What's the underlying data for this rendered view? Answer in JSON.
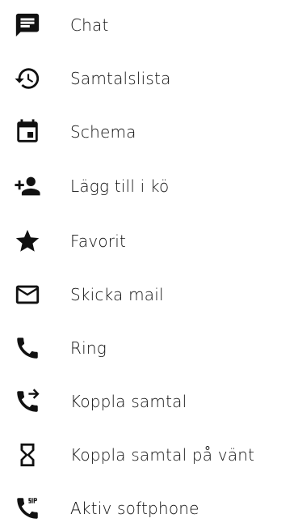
{
  "menu": {
    "items": [
      {
        "id": "chat",
        "label": "Chat",
        "icon": "chat-icon"
      },
      {
        "id": "call-list",
        "label": "Samtalslista",
        "icon": "history-icon"
      },
      {
        "id": "schedule",
        "label": "Schema",
        "icon": "calendar-icon"
      },
      {
        "id": "add-to-queue",
        "label": "Lägg till i kö",
        "icon": "person-add-icon"
      },
      {
        "id": "favorite",
        "label": "Favorit",
        "icon": "star-icon"
      },
      {
        "id": "send-mail",
        "label": "Skicka mail",
        "icon": "mail-icon"
      },
      {
        "id": "call",
        "label": "Ring",
        "icon": "phone-icon"
      },
      {
        "id": "transfer-call",
        "label": "Koppla samtal",
        "icon": "phone-forward-icon"
      },
      {
        "id": "transfer-on-hold",
        "label": "Koppla samtal på vänt",
        "icon": "hourglass-icon"
      },
      {
        "id": "softphone",
        "label": "Aktiv softphone",
        "icon": "sip-phone-icon"
      }
    ]
  },
  "colors": {
    "icon": "#111111",
    "text": "#111111",
    "background": "#ffffff"
  }
}
